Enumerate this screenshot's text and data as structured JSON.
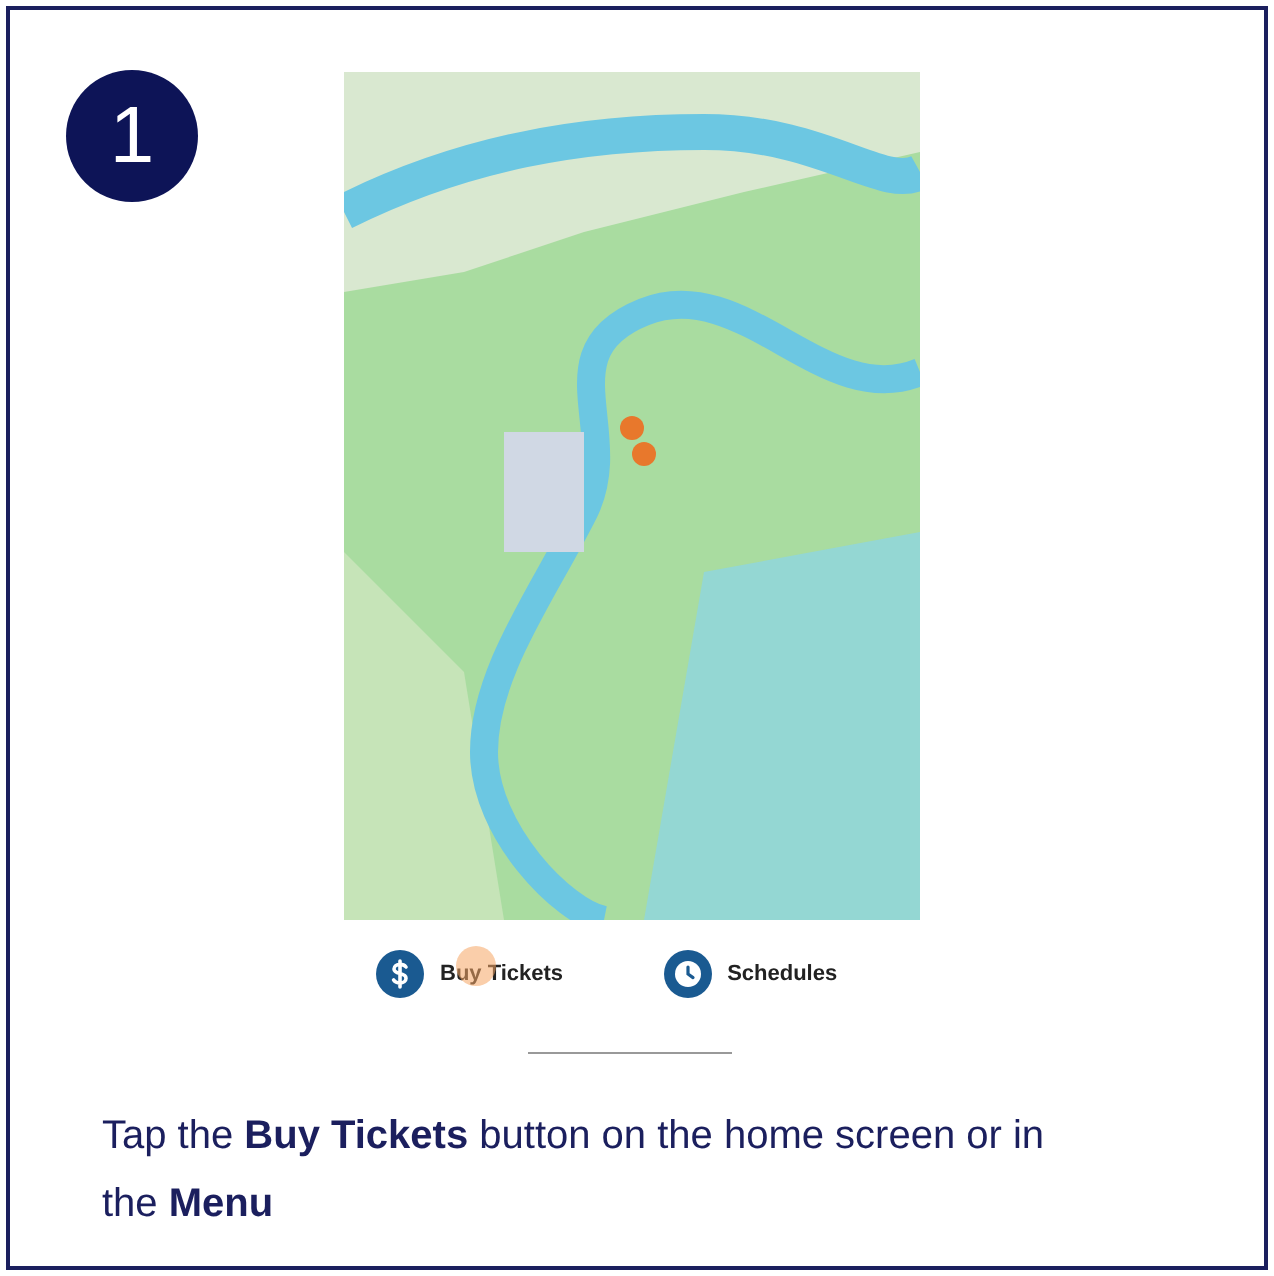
{
  "step": {
    "number": "1"
  },
  "app_screen": {
    "nav_items": [
      {
        "kind": "dollar",
        "label": "Buy Tickets",
        "tapped": true
      },
      {
        "kind": "clock",
        "label": "Schedules",
        "tapped": false
      }
    ]
  },
  "caption": "Tap the **Buy Tickets** button on the home screen or in the **Menu**"
}
